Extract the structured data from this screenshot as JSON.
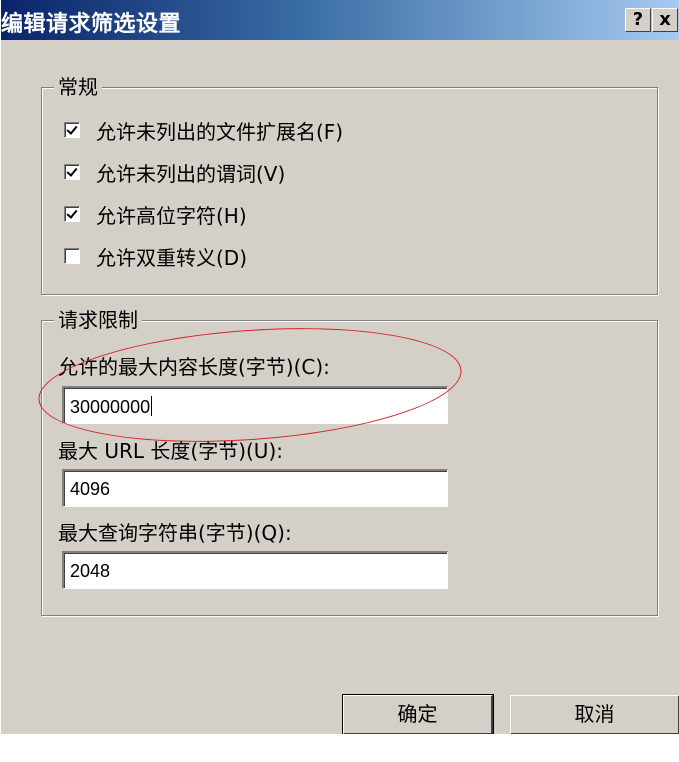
{
  "window": {
    "title": "编辑请求筛选设置",
    "help_button": "?",
    "close_button": "x"
  },
  "general": {
    "legend": "常规",
    "options": [
      {
        "label": "允许未列出的文件扩展名(F)",
        "checked": true
      },
      {
        "label": "允许未列出的谓词(V)",
        "checked": true
      },
      {
        "label": "允许高位字符(H)",
        "checked": true
      },
      {
        "label": "允许双重转义(D)",
        "checked": false
      }
    ]
  },
  "limits": {
    "legend": "请求限制",
    "max_content_length_label": "允许的最大内容长度(字节)(C):",
    "max_content_length_value": "30000000",
    "max_url_length_label": "最大 URL 长度(字节)(U):",
    "max_url_length_value": "4096",
    "max_query_string_label": "最大查询字符串(字节)(Q):",
    "max_query_string_value": "2048"
  },
  "buttons": {
    "ok": "确定",
    "cancel": "取消"
  },
  "annotation": {
    "ellipse_color": "#d0242b"
  }
}
